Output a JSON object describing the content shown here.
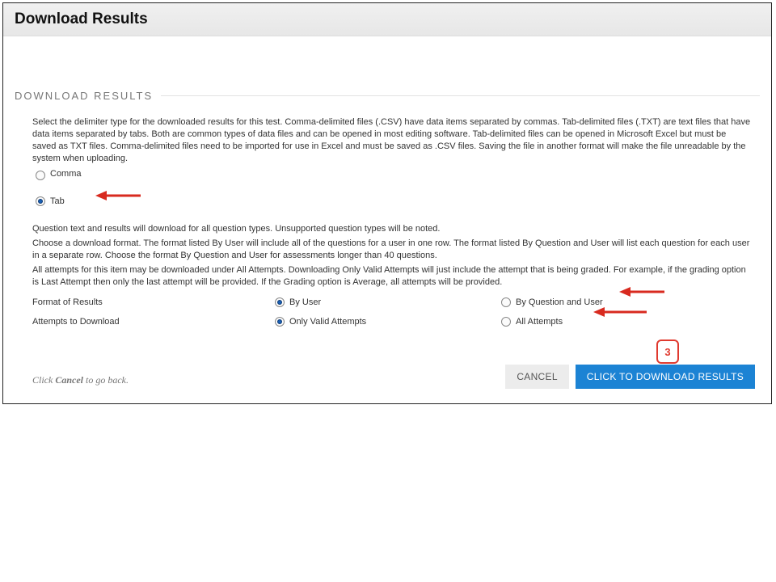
{
  "header": {
    "title": "Download Results"
  },
  "section": {
    "title": "DOWNLOAD RESULTS"
  },
  "intro_text": "Select the delimiter type for the downloaded results for this test. Comma-delimited files (.CSV) have data items separated by commas. Tab-delimited files (.TXT) are text files that have data items separated by tabs. Both are common types of data files and can be opened in most editing software. Tab-delimited files can be opened in Microsoft Excel but must be saved as TXT files. Comma-delimited files need to be imported for use in Excel and must be saved as .CSV files. Saving the file in another format will make the file unreadable by the system when uploading.",
  "delimiter": {
    "options": {
      "comma": "Comma",
      "tab": "Tab"
    },
    "selected": "tab"
  },
  "mid_text_lines": [
    "Question text and results will download for all question types. Unsupported question types will be noted.",
    "Choose a download format. The format listed By User will include all of the questions for a user in one row. The format listed By Question and User will list each question for each user in a separate row. Choose the format By Question and User for assessments longer than 40 questions.",
    "All attempts for this item may be downloaded under All Attempts. Downloading Only Valid Attempts will just include the attempt that is being graded. For example, if the grading option is Last Attempt then only the last attempt will be provided. If the Grading option is Average, all attempts will be provided."
  ],
  "format": {
    "label": "Format of Results",
    "options": {
      "by_user": "By User",
      "by_question_user": "By Question and User"
    },
    "selected": "by_user"
  },
  "attempts": {
    "label": "Attempts to Download",
    "options": {
      "valid": "Only Valid Attempts",
      "all": "All Attempts"
    },
    "selected": "valid"
  },
  "footer_help": {
    "prefix": "Click ",
    "strong": "Cancel",
    "suffix": " to go back."
  },
  "buttons": {
    "cancel": "CANCEL",
    "download": "CLICK TO DOWNLOAD RESULTS"
  },
  "callout": {
    "number": "3"
  }
}
